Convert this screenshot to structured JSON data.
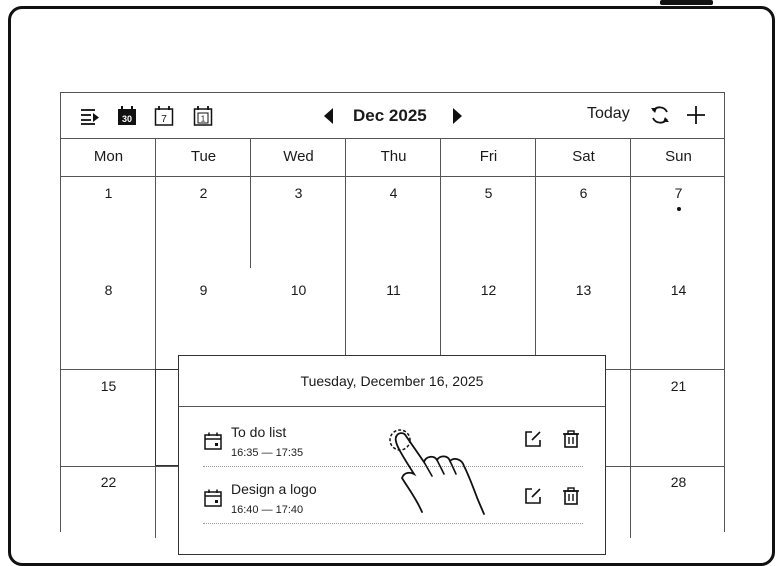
{
  "toolbar": {
    "month_label": "Dec 2025",
    "today_label": "Today",
    "icons": [
      "agenda-icon",
      "month-view-icon",
      "week-view-icon",
      "day-view-icon",
      "prev-month-icon",
      "next-month-icon",
      "sync-icon",
      "add-icon"
    ]
  },
  "weekdays": [
    "Mon",
    "Tue",
    "Wed",
    "Thu",
    "Fri",
    "Sat",
    "Sun"
  ],
  "weeks": [
    [
      "1",
      "2",
      "3",
      "4",
      "5",
      "6",
      "7"
    ],
    [
      "8",
      "9",
      "10",
      "11",
      "12",
      "13",
      "14"
    ],
    [
      "15",
      "",
      "",
      "",
      "",
      "",
      "21"
    ],
    [
      "22",
      "",
      "",
      "",
      "",
      "",
      "28"
    ]
  ],
  "popup": {
    "title": "Tuesday, December 16, 2025",
    "events": [
      {
        "title": "To do list",
        "time": "16:35 — 17:35"
      },
      {
        "title": "Design a logo",
        "time": "16:40 — 17:40"
      }
    ]
  },
  "colors": {
    "ink": "#1a1a1a",
    "line": "#555555",
    "background": "#ffffff"
  }
}
